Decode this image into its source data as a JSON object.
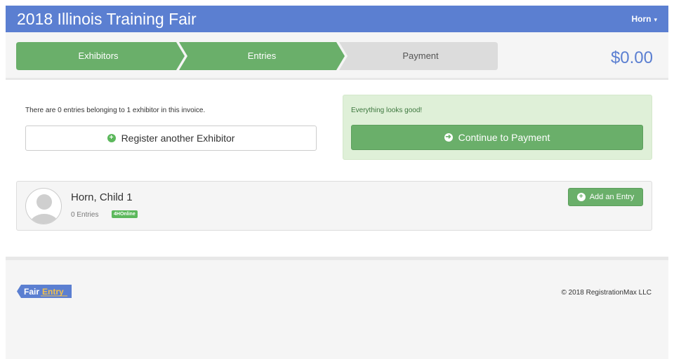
{
  "header": {
    "title": "2018 Illinois Training Fair",
    "user": "Horn",
    "user_caret": "▾"
  },
  "steps": [
    {
      "label": "Exhibitors",
      "state": "complete"
    },
    {
      "label": "Entries",
      "state": "complete"
    },
    {
      "label": "Payment",
      "state": "pending"
    }
  ],
  "total": "$0.00",
  "summary": {
    "text": "There are 0 entries belonging to 1 exhibitor in this invoice.",
    "register_button": "Register another Exhibitor",
    "register_icon": "plus-circle-icon"
  },
  "status": {
    "message": "Everything looks good!",
    "continue_button": "Continue to Payment",
    "continue_icon": "arrow-circle-right-icon"
  },
  "exhibitor": {
    "name": "Horn, Child 1",
    "entries": "0 Entries",
    "badge": "4HOnline",
    "add_button": "Add an Entry",
    "add_icon": "plus-circle-icon"
  },
  "footer": {
    "logo_text": "FairEntry",
    "copyright": "© 2018 RegistrationMax LLC"
  },
  "colors": {
    "brand_blue": "#5b7fd1",
    "step_complete": "#6aaf6a",
    "step_pending": "#dcdcdc",
    "success_bg": "#dff0d8",
    "badge_green": "#5cb85c",
    "logo_gold": "#f2c14e"
  }
}
